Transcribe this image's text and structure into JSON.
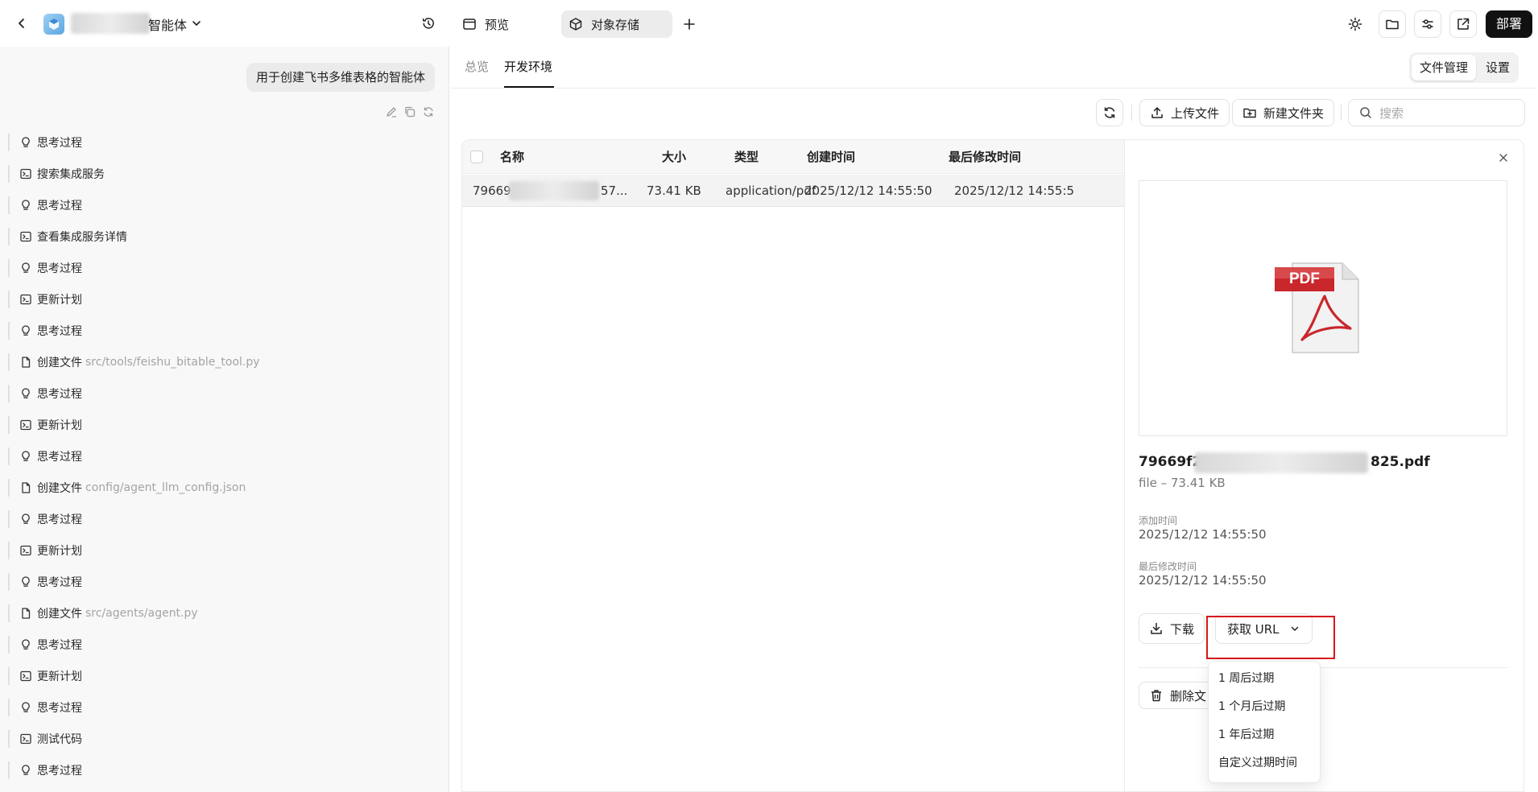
{
  "app": {
    "name": "智能体",
    "back_icon": "chevron-left-icon",
    "history_icon": "history-icon"
  },
  "tabs": [
    {
      "label": "预览",
      "icon": "window-icon"
    },
    {
      "label": "对象存储",
      "icon": "box-icon",
      "active": true
    }
  ],
  "toolbar": {
    "deploy_label": "部署",
    "icons": [
      "sun-icon",
      "folder-icon",
      "settings-sliders-icon",
      "external-link-icon"
    ]
  },
  "chat": {
    "user_message": "用于创建飞书多维表格的智能体",
    "steps": [
      {
        "kind": "think",
        "label": "思考过程"
      },
      {
        "kind": "terminal",
        "label": "搜索集成服务"
      },
      {
        "kind": "think",
        "label": "思考过程"
      },
      {
        "kind": "terminal",
        "label": "查看集成服务详情"
      },
      {
        "kind": "think",
        "label": "思考过程"
      },
      {
        "kind": "terminal",
        "label": "更新计划"
      },
      {
        "kind": "think",
        "label": "思考过程"
      },
      {
        "kind": "file",
        "label": "创建文件",
        "path": "src/tools/feishu_bitable_tool.py"
      },
      {
        "kind": "think",
        "label": "思考过程"
      },
      {
        "kind": "terminal",
        "label": "更新计划"
      },
      {
        "kind": "think",
        "label": "思考过程"
      },
      {
        "kind": "file",
        "label": "创建文件",
        "path": "config/agent_llm_config.json"
      },
      {
        "kind": "think",
        "label": "思考过程"
      },
      {
        "kind": "terminal",
        "label": "更新计划"
      },
      {
        "kind": "think",
        "label": "思考过程"
      },
      {
        "kind": "file",
        "label": "创建文件",
        "path": "src/agents/agent.py"
      },
      {
        "kind": "think",
        "label": "思考过程"
      },
      {
        "kind": "terminal",
        "label": "更新计划"
      },
      {
        "kind": "think",
        "label": "思考过程"
      },
      {
        "kind": "terminal",
        "label": "测试代码"
      },
      {
        "kind": "think",
        "label": "思考过程"
      }
    ]
  },
  "storage": {
    "tabs": [
      {
        "label": "总览"
      },
      {
        "label": "开发环境",
        "active": true
      }
    ],
    "mode_buttons": [
      {
        "label": "文件管理",
        "active": true
      },
      {
        "label": "设置"
      }
    ],
    "actions": {
      "upload_label": "上传文件",
      "new_folder_label": "新建文件夹",
      "search_placeholder": "搜索"
    },
    "table": {
      "columns": [
        "名称",
        "大小",
        "类型",
        "创建时间",
        "最后修改时间"
      ],
      "rows": [
        {
          "name_start": "79669",
          "name_end": "57...",
          "size": "73.41 KB",
          "type": "application/pdf",
          "created": "2025/12/12 14:55:50",
          "modified": "2025/12/12 14:55:5"
        }
      ]
    },
    "detail": {
      "file_icon_text": "PDF",
      "filename_start": "79669f2",
      "filename_end": "825.pdf",
      "meta": "file – 73.41 KB",
      "added_label": "添加时间",
      "added_value": "2025/12/12 14:55:50",
      "modified_label": "最后修改时间",
      "modified_value": "2025/12/12 14:55:50",
      "download_label": "下载",
      "get_url_label": "获取 URL",
      "delete_label": "删除文",
      "url_options": [
        "1 周后过期",
        "1 个月后过期",
        "1 年后过期",
        "自定义过期时间"
      ]
    }
  },
  "colors": {
    "highlight": "#d9161c",
    "deploy_bg": "#111111",
    "pdf_red": "#c8272c"
  }
}
